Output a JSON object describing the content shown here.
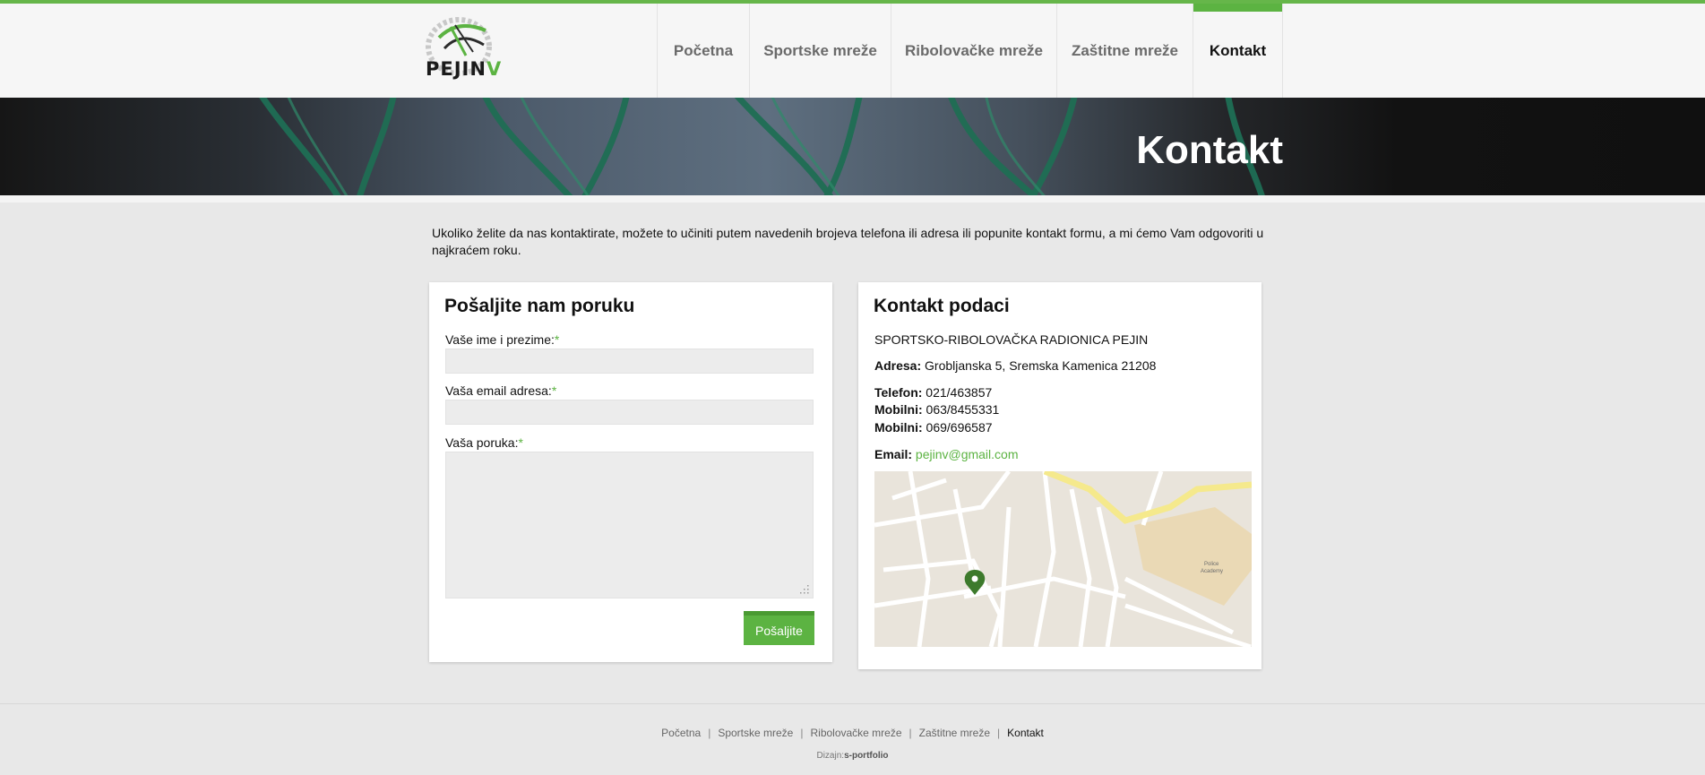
{
  "brand": {
    "logo_text": "PEJIN",
    "logo_accent": "V",
    "accent_color": "#5cb342"
  },
  "nav": {
    "items": [
      {
        "label": "Početna",
        "active": false
      },
      {
        "label": "Sportske mreže",
        "active": false
      },
      {
        "label": "Ribolovačke mreže",
        "active": false
      },
      {
        "label": "Zaštitne mreže",
        "active": false
      },
      {
        "label": "Kontakt",
        "active": true
      }
    ]
  },
  "banner": {
    "title": "Kontakt"
  },
  "intro": "Ukoliko želite da nas kontaktirate, možete to učiniti putem navedenih brojeva telefona ili adresa ili popunite kontakt formu, a mi ćemo Vam odgovoriti u najkraćem roku.",
  "form": {
    "title": "Pošaljite nam poruku",
    "name_label": "Vaše ime i prezime:",
    "email_label": "Vaša email adresa:",
    "message_label": "Vaša poruka:",
    "required_mark": "*",
    "name_value": "",
    "email_value": "",
    "message_value": "",
    "submit_label": "Pošaljite"
  },
  "contact": {
    "title": "Kontakt podaci",
    "company": "SPORTSKO-RIBOLOVAČKA RADIONICA PEJIN",
    "address_label": "Adresa:",
    "address": "Grobljanska 5, Sremska Kamenica 21208",
    "phone_label": "Telefon:",
    "phone": "021/463857",
    "mobile_label": "Mobilni:",
    "mobile1": "063/8455331",
    "mobile2": "069/696587",
    "email_label": "Email:",
    "email": "pejinv@gmail.com"
  },
  "map": {
    "marker_icon": "map-pin-icon",
    "marker_color": "#3d7a2c",
    "area_label_1": "Police",
    "area_label_2": "Academy"
  },
  "footer": {
    "links": [
      "Početna",
      "Sportske mreže",
      "Ribolovačke mreže",
      "Zaštitne mreže",
      "Kontakt"
    ],
    "separator": "|",
    "credit_prefix": "Dizajn:",
    "credit_name": "s-portfolio"
  }
}
